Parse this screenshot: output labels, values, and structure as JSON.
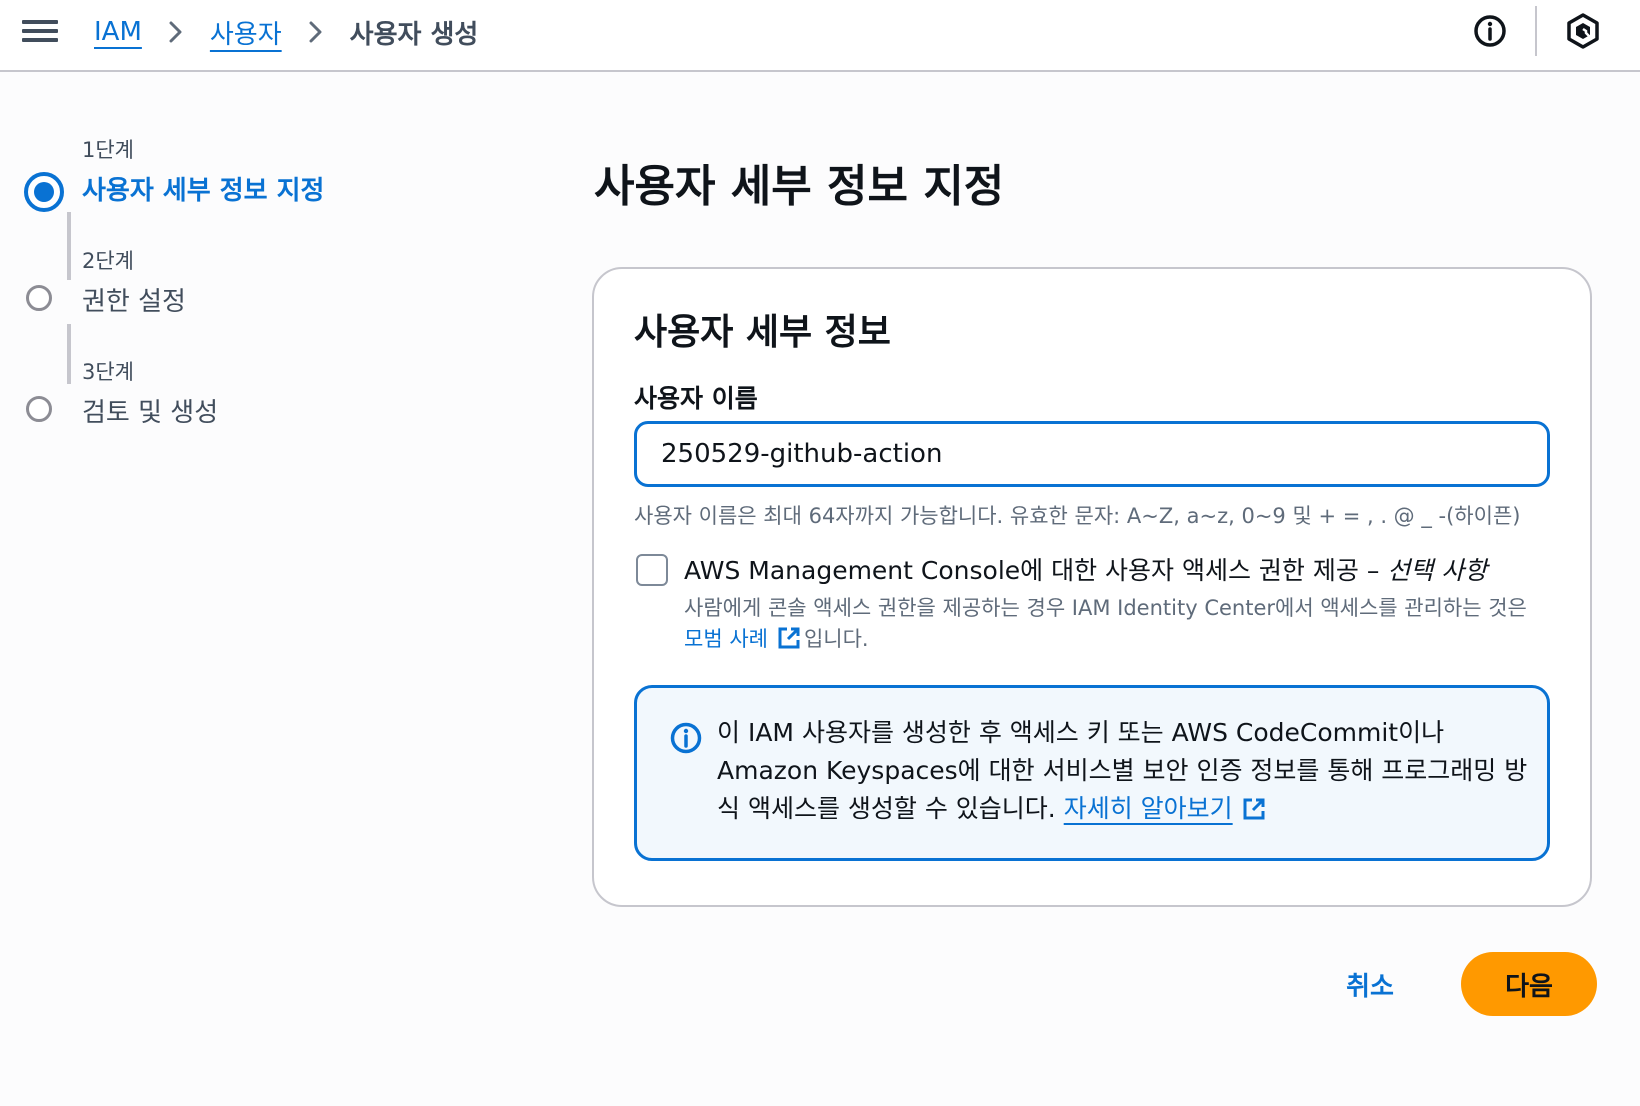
{
  "header": {
    "menu_icon": "hamburger-menu-icon",
    "breadcrumbs": [
      {
        "label": "IAM",
        "link": true
      },
      {
        "label": "사용자",
        "link": true
      },
      {
        "label": "사용자 생성",
        "link": false
      }
    ],
    "info_icon": "info-icon",
    "settings_icon": "hexagon-q-icon"
  },
  "wizard": {
    "steps": [
      {
        "number": "1단계",
        "label": "사용자 세부 정보 지정",
        "state": "current"
      },
      {
        "number": "2단계",
        "label": "권한 설정",
        "state": "upcoming"
      },
      {
        "number": "3단계",
        "label": "검토 및 생성",
        "state": "upcoming"
      }
    ]
  },
  "main": {
    "page_title": "사용자 세부 정보 지정",
    "panel": {
      "title": "사용자 세부 정보",
      "username_label": "사용자 이름",
      "username_value": "250529-github-action",
      "username_constraint": "사용자 이름은 최대 64자까지 가능합니다. 유효한 문자: A~Z, a~z, 0~9 및 + = , . @ _ -(하이픈)",
      "console_access": {
        "checked": false,
        "label": "AWS Management Console에 대한 사용자 액세스 권한 제공 –",
        "optional": "선택 사항",
        "description_before": "사람에게 콘솔 액세스 권한을 제공하는 경우 IAM Identity Center에서 액세스를 관리하는 것은",
        "description_link": "모범 사례",
        "description_after": "입니다."
      },
      "info_alert": {
        "icon": "info-circle-icon",
        "text": "이 IAM 사용자를 생성한 후 액세스 키 또는 AWS CodeCommit이나 Amazon Keyspaces에 대한 서비스별 보안 인증 정보를 통해 프로그래밍 방식 액세스를 생성할 수 있습니다.",
        "link": "자세히 알아보기",
        "link_icon": "external-link-icon"
      }
    }
  },
  "footer": {
    "cancel_label": "취소",
    "next_label": "다음"
  },
  "colors": {
    "link": "#0972d3",
    "primary_button": "#ff9900",
    "alert_background": "#f2f8fd",
    "border": "#c6c6cd",
    "secondary_text": "#5f6b7a"
  }
}
